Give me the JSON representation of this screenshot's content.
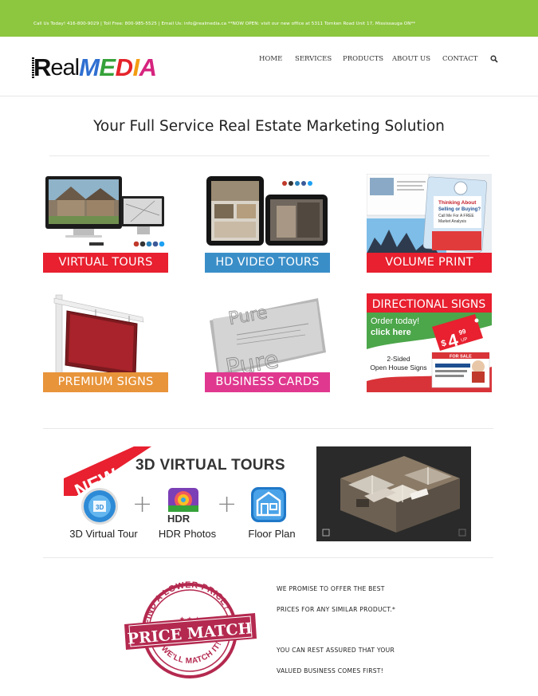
{
  "topbar": {
    "text": "Call Us Today! 416-800-9029 | Toll Free: 800-985-5525  |  Email Us: info@realmedia.ca  **NOW OPEN: visit our new office at 5311 Tomken Road Unit 17, Mississauga ON**"
  },
  "logo": {
    "real": "Real",
    "media": "MEDIA"
  },
  "nav": {
    "items": [
      "HOME",
      "SERVICES",
      "PRODUCTS",
      "ABOUT US",
      "CONTACT"
    ],
    "search_icon": "search-icon"
  },
  "page_title": "Your Full Service Real Estate Marketing Solution",
  "tiles": [
    {
      "label": "VIRTUAL TOURS",
      "color": "#e8202f"
    },
    {
      "label": "HD VIDEO TOURS",
      "color": "#3a8ec8"
    },
    {
      "label": "VOLUME PRINT",
      "color": "#e8202f"
    },
    {
      "label": "PREMIUM SIGNS",
      "color": "#e8943a"
    },
    {
      "label": "BUSINESS CARDS",
      "color": "#e0388f"
    }
  ],
  "directional": {
    "title": "DIRECTIONAL SIGNS",
    "order": "Order today!",
    "click": "click here",
    "price_main": "4",
    "price_sup": "99",
    "price_prefix": "$",
    "price_up": "UP",
    "two_sided_1": "2-Sided",
    "two_sided_2": "Open House Signs",
    "for_sale": "FOR SALE",
    "title_color": "#e8202f",
    "bg_color": "#3b9a3b"
  },
  "volume_print": {
    "line1": "Thinking About",
    "line2": "Selling or Buying?",
    "line3": "Call Me For A FREE",
    "line4": "Market Analysis"
  },
  "business_card": {
    "word": "Pure"
  },
  "vt3d": {
    "new_label": "NEW",
    "title": "3D VIRTUAL TOURS",
    "features": [
      "3D Virtual Tour",
      "HDR Photos",
      "Floor Plan"
    ],
    "hdr_badge": "HDR",
    "plus": "+"
  },
  "price_match": {
    "top_text": "FIND A LOWER PRICE?",
    "main_text": "PRICE MATCH",
    "bottom_text": "WE'LL MATCH IT!",
    "stars": "★ ★ ★",
    "color": "#b4294f"
  },
  "promise": {
    "line1": "WE PROMISE TO OFFER THE BEST",
    "line2": "PRICES FOR ANY SIMILAR PRODUCT.*",
    "line3": "YOU CAN REST ASSURED THAT YOUR",
    "line4": "VALUED BUSINESS COMES FIRST!"
  }
}
